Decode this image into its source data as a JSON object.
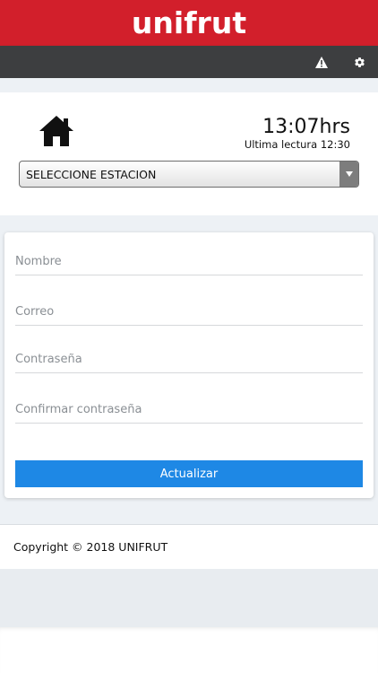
{
  "header": {
    "brand": "unifrut",
    "brand_color": "#d21f2b",
    "toolbar_color": "#3d3e40",
    "icons": [
      "warning-icon",
      "gear-icon"
    ]
  },
  "station": {
    "time": "13:07hrs",
    "last_reading": "Ultima lectura 12:30",
    "select_value": "SELECCIONE ESTACION",
    "home_icon": "home-icon"
  },
  "form": {
    "name_placeholder": "Nombre",
    "email_placeholder": "Correo",
    "password_placeholder": "Contraseña",
    "confirm_placeholder": "Confirmar contraseña",
    "submit_label": "Actualizar",
    "submit_color": "#1e88e5"
  },
  "footer": {
    "copyright": "Copyright © 2018 UNIFRUT"
  }
}
